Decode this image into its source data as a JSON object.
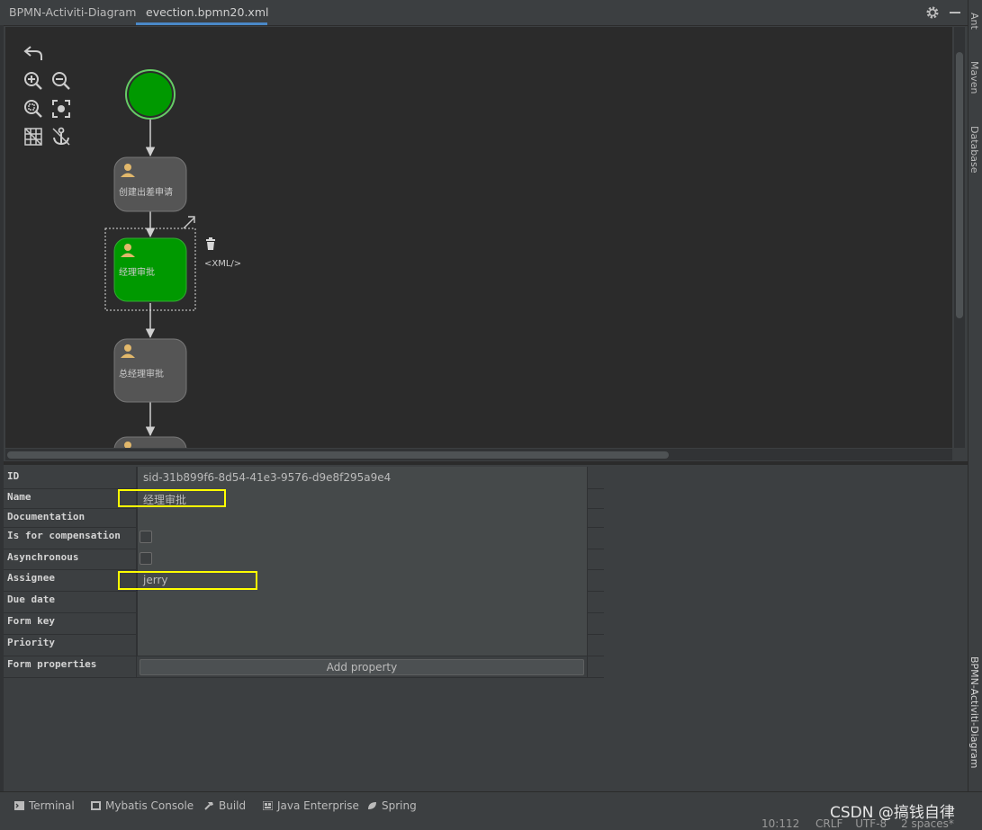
{
  "tabs": [
    {
      "label": "BPMN-Activiti-Diagram",
      "active": false
    },
    {
      "label": "evection.bpmn20.xml",
      "active": true
    }
  ],
  "header_icons": [
    "gear-icon",
    "minimize-icon"
  ],
  "right_tools": {
    "ant": "Ant",
    "maven": "Maven",
    "database": "Database",
    "bpmn": "BPMN-Activiti-Diagram"
  },
  "diagram": {
    "toolbar": [
      "undo-icon",
      "zoom-in-icon",
      "zoom-out-icon",
      "zoom-fit-icon",
      "center-icon",
      "grid-icon",
      "anchor-icon"
    ],
    "tasks": [
      {
        "name": "创建出差申请",
        "selected": false
      },
      {
        "name": "经理审批",
        "selected": true
      },
      {
        "name": "总经理审批",
        "selected": false
      }
    ],
    "xml_label": "<XML/>",
    "colors": {
      "start_event": "#009900",
      "selected_task": "#009900",
      "task": "#555555",
      "canvas": "#2b2b2b"
    }
  },
  "properties": {
    "rows": [
      {
        "key": "ID",
        "value": "sid-31b899f6-8d54-41e3-9576-d9e8f295a9e4"
      },
      {
        "key": "Name",
        "value": "经理审批"
      },
      {
        "key": "Documentation",
        "value": ""
      },
      {
        "key": "Is for compensation",
        "value": ""
      },
      {
        "key": "Asynchronous",
        "value": ""
      },
      {
        "key": "Assignee",
        "value": "jerry"
      },
      {
        "key": "Due date",
        "value": ""
      },
      {
        "key": "Form key",
        "value": ""
      },
      {
        "key": "Priority",
        "value": ""
      },
      {
        "key": "Form properties",
        "value": ""
      }
    ],
    "add_property": "Add property",
    "highlight_color": "#ffff00"
  },
  "bottom_tools": [
    {
      "label": "Terminal",
      "icon": "terminal-icon"
    },
    {
      "label": "Mybatis Console",
      "icon": "console-icon"
    },
    {
      "label": "Build",
      "icon": "hammer-icon"
    },
    {
      "label": "Java Enterprise",
      "icon": "java-enterprise-icon"
    },
    {
      "label": "Spring",
      "icon": "spring-icon"
    }
  ],
  "status": {
    "position": "10:112",
    "line_sep": "CRLF",
    "encoding": "UTF-8",
    "indent": "2 spaces*"
  },
  "watermark": "CSDN @搞钱自律"
}
